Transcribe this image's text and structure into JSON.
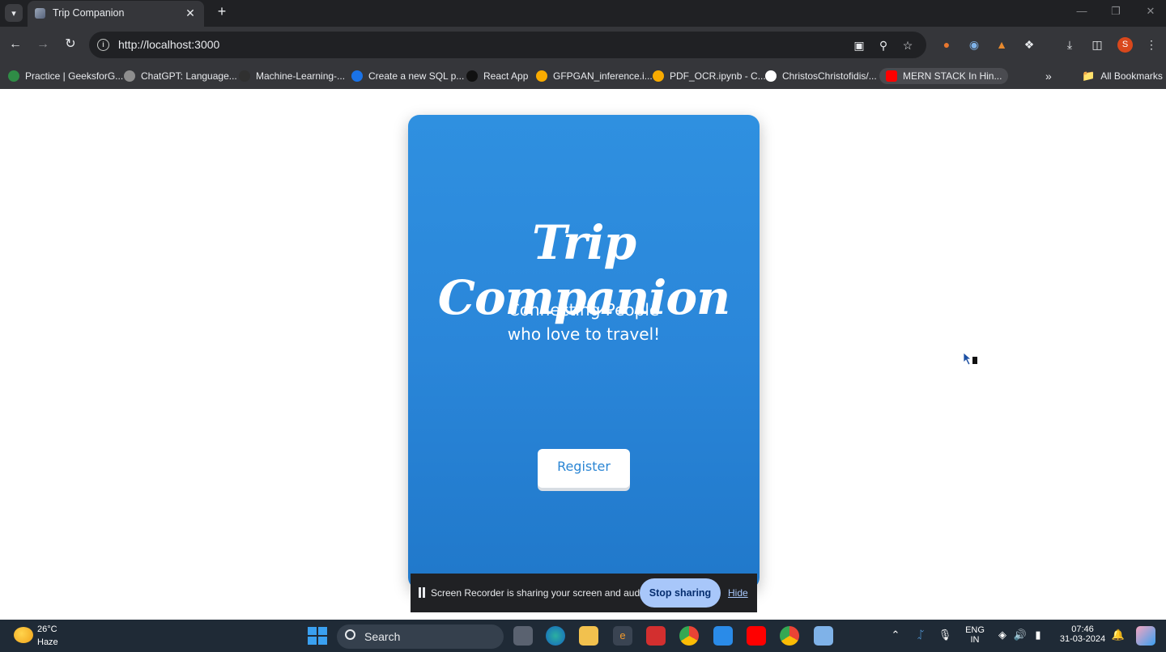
{
  "browser": {
    "tab_title": "Trip Companion",
    "url": "http://localhost:3000",
    "profile_initial": "S",
    "bookmarks": [
      {
        "label": "Practice | GeeksforG...",
        "icon": "geeksforgeeks-icon",
        "color": "#2f8d46"
      },
      {
        "label": "ChatGPT: Language...",
        "icon": "chatgpt-icon",
        "color": "#8e8e8e"
      },
      {
        "label": "Machine-Learning-...",
        "icon": "github-icon",
        "color": "#303030"
      },
      {
        "label": "Create a new SQL p...",
        "icon": "sql-icon",
        "color": "#1a73e8"
      },
      {
        "label": "React App",
        "icon": "react-icon",
        "color": "#111111"
      },
      {
        "label": "GFPGAN_inference.i...",
        "icon": "colab-icon",
        "color": "#f9ab00"
      },
      {
        "label": "PDF_OCR.ipynb - C...",
        "icon": "colab-icon",
        "color": "#f9ab00"
      },
      {
        "label": "ChristosChristofidis/...",
        "icon": "github-icon",
        "color": "#ffffff"
      },
      {
        "label": "MERN STACK In Hin...",
        "icon": "youtube-icon",
        "color": "#ff0000"
      }
    ],
    "all_bookmarks_label": "All Bookmarks"
  },
  "app": {
    "title": "Trip Companion",
    "tagline_line1": "Connecting People",
    "tagline_line2": "who love to travel!",
    "register_label": "Register",
    "accent_color": "#2a86d9"
  },
  "share_bar": {
    "message": "Screen Recorder is sharing your screen and audio.",
    "stop_label": "Stop sharing",
    "hide_label": "Hide"
  },
  "taskbar": {
    "weather_temp": "26°C",
    "weather_condition": "Haze",
    "search_label": "Search",
    "language_line1": "ENG",
    "language_line2": "IN",
    "time": "07:46",
    "date": "31-03-2024"
  }
}
